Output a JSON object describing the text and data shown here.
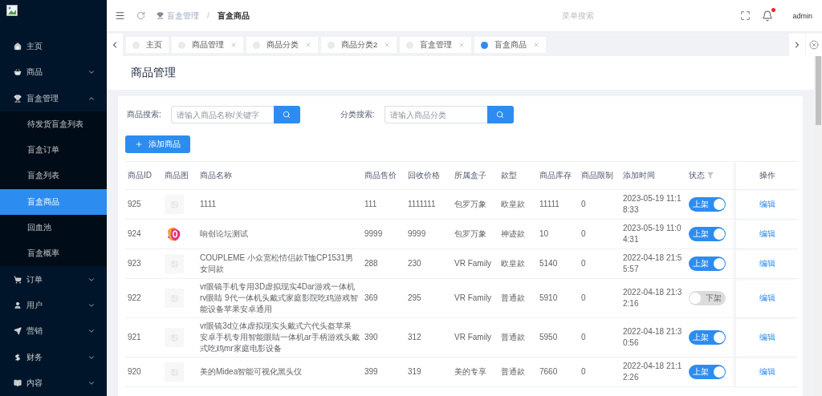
{
  "sidebar": {
    "items": [
      {
        "label": "主页",
        "selected": false
      },
      {
        "label": "商品",
        "selected": false,
        "expanded": false
      },
      {
        "label": "盲盒管理",
        "selected": false,
        "expanded": true,
        "children": [
          {
            "label": "待发货盲盒列表",
            "selected": false
          },
          {
            "label": "盲盒订单",
            "selected": false
          },
          {
            "label": "盲盒列表",
            "selected": false
          },
          {
            "label": "盲盒商品",
            "selected": true
          },
          {
            "label": "回血池",
            "selected": false
          },
          {
            "label": "盲盒概率",
            "selected": false
          }
        ]
      },
      {
        "label": "订单",
        "selected": false,
        "expanded": false
      },
      {
        "label": "用户",
        "selected": false,
        "expanded": false
      },
      {
        "label": "营销",
        "selected": false,
        "expanded": false
      },
      {
        "label": "财务",
        "selected": false,
        "expanded": false
      },
      {
        "label": "内容",
        "selected": false,
        "expanded": false
      }
    ]
  },
  "header": {
    "breadcrumb": [
      "盲盒管理",
      "盲盒商品"
    ],
    "breadcrumb_separator": "/",
    "menu_search": {
      "placeholder": "菜单搜索"
    },
    "notifications_dot": true,
    "user": "admin"
  },
  "tabs": [
    {
      "label": "主页",
      "selected": false,
      "closable": false
    },
    {
      "label": "商品管理",
      "selected": false,
      "closable": true
    },
    {
      "label": "商品分类",
      "selected": false,
      "closable": true
    },
    {
      "label": "商品分类2",
      "selected": false,
      "closable": true
    },
    {
      "label": "盲盒管理",
      "selected": false,
      "closable": true
    },
    {
      "label": "盲盒商品",
      "selected": true,
      "closable": true
    }
  ],
  "page_title": "商品管理",
  "filters": [
    {
      "label": "商品搜索:",
      "placeholder": "请输入商品名称/关键字"
    },
    {
      "label": "分类搜索:",
      "placeholder": "请输入商品分类"
    }
  ],
  "add_button": "添加商品",
  "table": {
    "columns": [
      "商品ID",
      "商品图",
      "商品名称",
      "商品售价",
      "回收价格",
      "所属盒子",
      "款型",
      "商品库存",
      "商品限制",
      "添加时间",
      "状态",
      "操作"
    ],
    "rows": [
      {
        "id": "925",
        "image": {
          "kind": "placeholder"
        },
        "name": "1111",
        "price": "111",
        "recycle": "1111111",
        "box": "包罗万象",
        "type": "欧皇款",
        "stock": "11111",
        "limit": "0",
        "time": "2023-05-19 11:18:33",
        "on": true,
        "status": "上架",
        "action": "编辑"
      },
      {
        "id": "924",
        "name": "响创论坛测试",
        "price": "9999",
        "recycle": "9999",
        "box": "包罗万象",
        "type": "神迹款",
        "stock": "10",
        "limit": "0",
        "time": "2023-05-19 11:04:31",
        "on": true,
        "status": "上架",
        "action": "编辑"
      },
      {
        "id": "923",
        "image": {
          "kind": "placeholder"
        },
        "name": "COUPLEME 小众宽松情侣款T恤CP1531男女同款",
        "price": "288",
        "recycle": "230",
        "box": "VR Family",
        "type": "欧皇款",
        "stock": "5140",
        "limit": "0",
        "time": "2022-04-18 21:55:57",
        "on": true,
        "status": "上架",
        "action": "编辑"
      },
      {
        "id": "922",
        "image": {
          "kind": "placeholder"
        },
        "name": "vr眼镜手机专用3D虚拟现实4Dar游戏一体机rv眼睛 9代一体机头戴式家庭影院吃鸡游戏智能设备苹果安卓通用",
        "price": "369",
        "recycle": "295",
        "box": "VR Family",
        "type": "普通款",
        "stock": "5910",
        "limit": "0",
        "time": "2022-04-18 21:32:16",
        "on": false,
        "status": "下架",
        "action": "编辑"
      },
      {
        "id": "921",
        "image": {
          "kind": "placeholder"
        },
        "name": "vr眼镜3d立体虚拟现实头戴式六代头盔苹果安卓手机专用智能眼睛一体机ar手柄游戏头戴式吃鸡mr家庭电影设备",
        "price": "390",
        "recycle": "312",
        "box": "VR Family",
        "type": "普通款",
        "stock": "5950",
        "limit": "0",
        "time": "2022-04-18 21:30:56",
        "on": true,
        "status": "上架",
        "action": "编辑"
      },
      {
        "id": "920",
        "image": {
          "kind": "placeholder"
        },
        "name": "美的Midea智能可视化黑头仪",
        "price": "399",
        "recycle": "319",
        "box": "美的专享",
        "type": "普通款",
        "stock": "7660",
        "limit": "0",
        "time": "2022-04-18 21:12:26",
        "on": true,
        "status": "上架",
        "action": "编辑"
      }
    ]
  }
}
